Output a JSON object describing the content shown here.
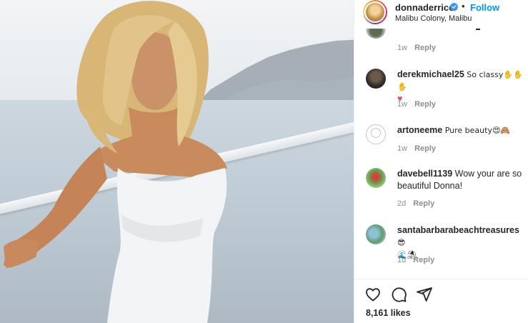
{
  "post": {
    "username": "donnaderrico",
    "follow_label": "Follow",
    "separator": "•",
    "location": "Malibu Colony, Malibu",
    "likes": "8,161 likes"
  },
  "top_partial": {
    "time": "1w",
    "reply_label": "Reply"
  },
  "comments": [
    {
      "user": "derekmichael25",
      "text": "So classy✋✋✋",
      "extra": "♥",
      "time": "1w",
      "reply_label": "Reply"
    },
    {
      "user": "artoneeme",
      "text": "Pure beauty😍🙈",
      "extra": "",
      "time": "1w",
      "reply_label": "Reply"
    },
    {
      "user": "davebell1139",
      "text": "Wow your are so beautiful Donna!",
      "extra": "",
      "time": "2d",
      "reply_label": "Reply"
    },
    {
      "user": "santabarbarabeachtreasures",
      "text": "😎",
      "extra": "🌊⛱",
      "time": "1d",
      "reply_label": "Reply"
    }
  ],
  "icons": {
    "like": "heart-icon",
    "comment": "comment-icon",
    "share": "share-icon",
    "verified": "verified-badge-icon"
  },
  "colors": {
    "accent": "#0095f6",
    "verified": "#3897f0",
    "heart": "#ed4956",
    "muted": "#8e8e8e"
  }
}
